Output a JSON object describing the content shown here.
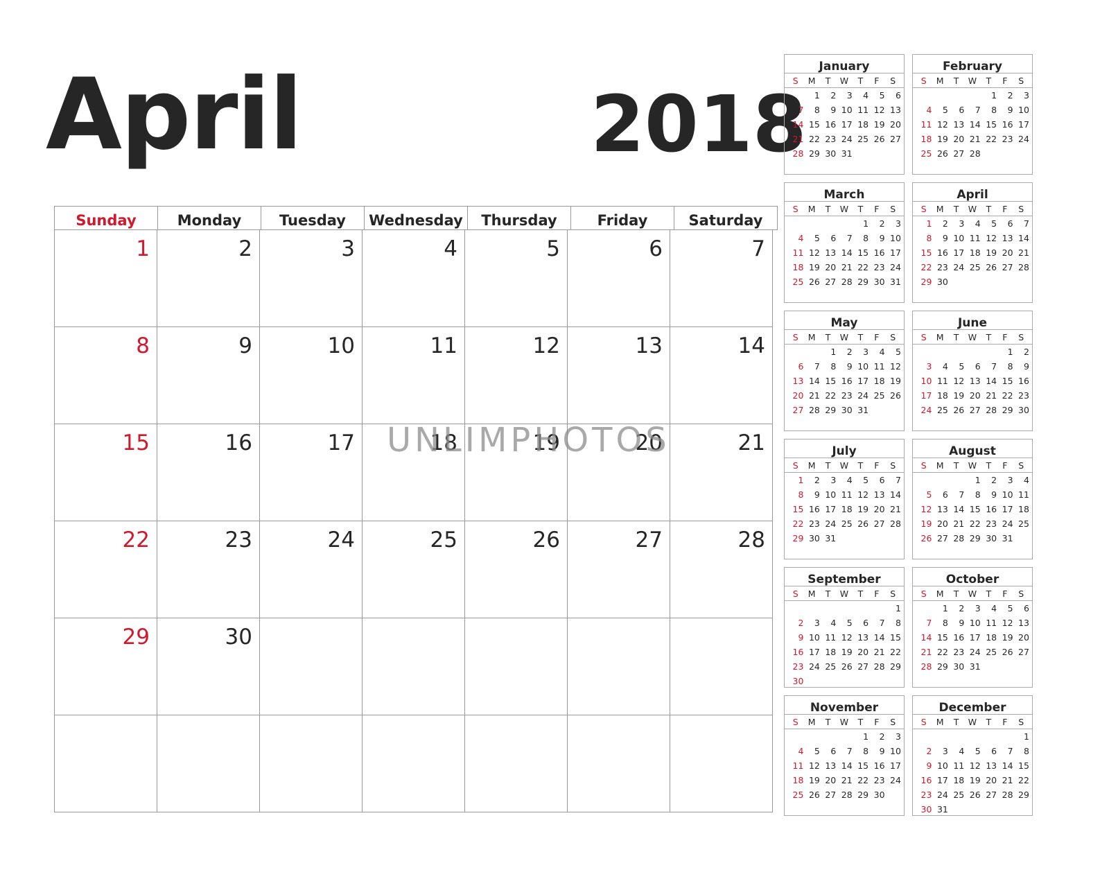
{
  "header": {
    "month": "April",
    "year": "2018"
  },
  "main_calendar": {
    "weekdays": [
      "Sunday",
      "Monday",
      "Tuesday",
      "Wednesday",
      "Thursday",
      "Friday",
      "Saturday"
    ],
    "weeks": [
      [
        "1",
        "2",
        "3",
        "4",
        "5",
        "6",
        "7"
      ],
      [
        "8",
        "9",
        "10",
        "11",
        "12",
        "13",
        "14"
      ],
      [
        "15",
        "16",
        "17",
        "18",
        "19",
        "20",
        "21"
      ],
      [
        "22",
        "23",
        "24",
        "25",
        "26",
        "27",
        "28"
      ],
      [
        "29",
        "30",
        "",
        "",
        "",
        "",
        ""
      ],
      [
        "",
        "",
        "",
        "",
        "",
        "",
        ""
      ]
    ]
  },
  "accent_color": "#d0192c",
  "mini_day_headers": [
    "S",
    "M",
    "T",
    "W",
    "T",
    "F",
    "S"
  ],
  "mini_calendars": [
    {
      "name": "January",
      "start": 1,
      "days": 31
    },
    {
      "name": "February",
      "start": 4,
      "days": 28
    },
    {
      "name": "March",
      "start": 4,
      "days": 31
    },
    {
      "name": "April",
      "start": 0,
      "days": 30
    },
    {
      "name": "May",
      "start": 2,
      "days": 31
    },
    {
      "name": "June",
      "start": 5,
      "days": 30
    },
    {
      "name": "July",
      "start": 0,
      "days": 31
    },
    {
      "name": "August",
      "start": 3,
      "days": 31
    },
    {
      "name": "September",
      "start": 6,
      "days": 30
    },
    {
      "name": "October",
      "start": 1,
      "days": 31
    },
    {
      "name": "November",
      "start": 4,
      "days": 30
    },
    {
      "name": "December",
      "start": 6,
      "days": 31
    }
  ],
  "watermark": "UNLIMPHOTOS"
}
